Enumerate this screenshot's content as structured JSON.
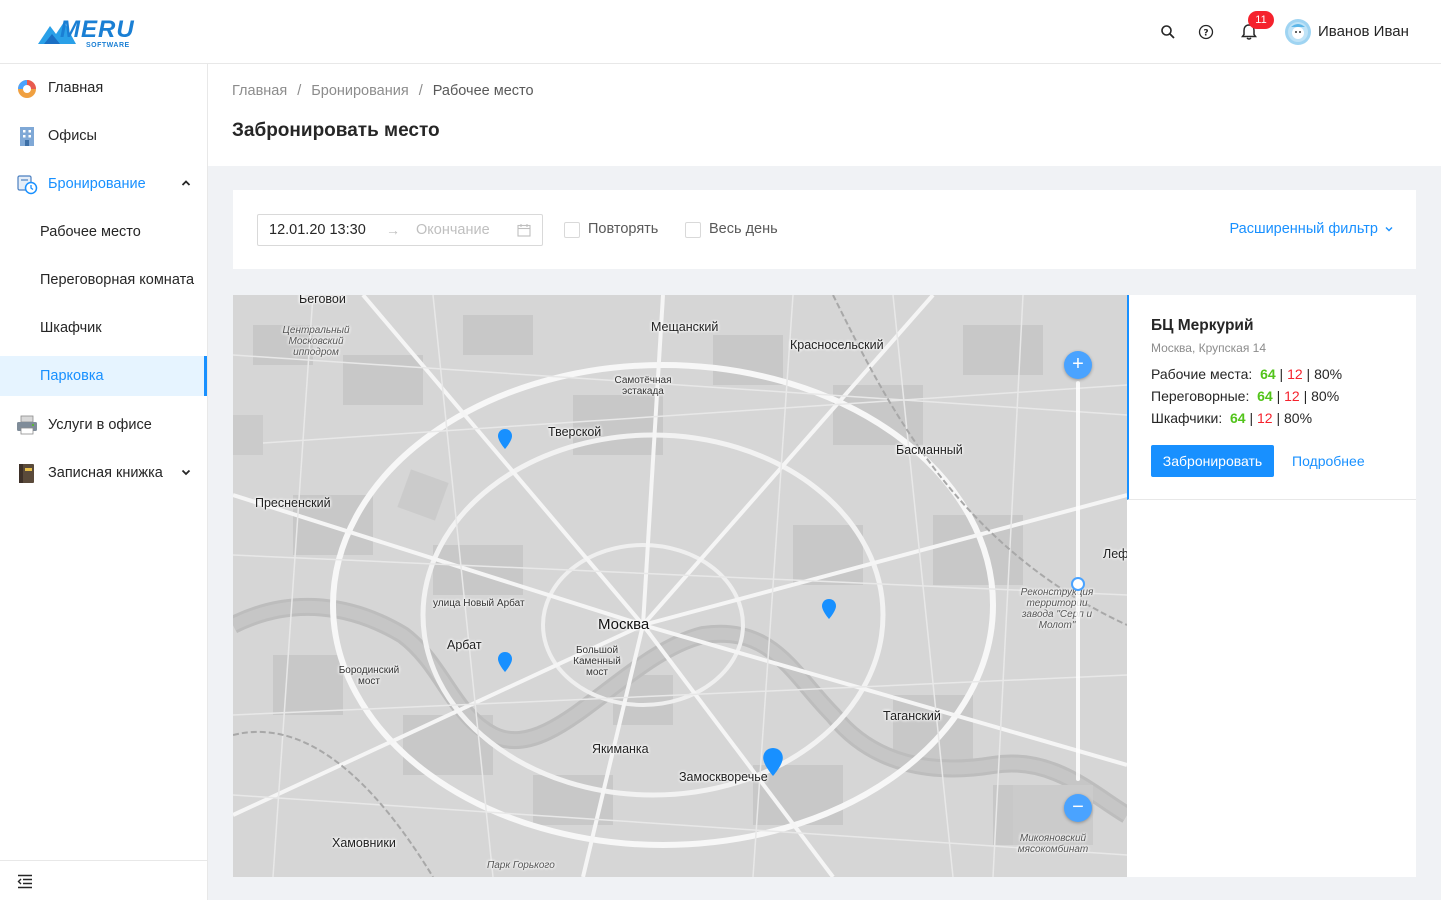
{
  "brand": {
    "logo_text": "MERU",
    "logo_sub": "SOFTWARE"
  },
  "header": {
    "notifications_count": "11",
    "user_name": "Иванов Иван",
    "icons": [
      "search-icon",
      "help-icon",
      "bell-icon"
    ]
  },
  "sidebar": {
    "items": [
      {
        "label": "Главная",
        "icon": "dashboard-icon"
      },
      {
        "label": "Офисы",
        "icon": "building-icon"
      },
      {
        "label": "Бронирование",
        "icon": "booking-icon"
      },
      {
        "label": "Услуги в офисе",
        "icon": "printer-icon"
      },
      {
        "label": "Записная книжка",
        "icon": "notebook-icon"
      }
    ],
    "booking_sub": [
      {
        "label": "Рабочее место"
      },
      {
        "label": "Переговорная комната"
      },
      {
        "label": "Шкафчик"
      },
      {
        "label": "Парковка"
      }
    ],
    "active_sub": "Парковка"
  },
  "breadcrumb": [
    "Главная",
    "Бронирования",
    "Рабочее место"
  ],
  "page_title": "Забронировать место",
  "filter": {
    "start_value": "12.01.20 13:30",
    "end_placeholder": "Окончание",
    "repeat_label": "Повторять",
    "allday_label": "Весь день",
    "advanced_label": "Расширенный фильтр"
  },
  "map": {
    "labels": {
      "meshchansky": "Мещанский",
      "krasnoselsky": "Красносельский",
      "tverskoy": "Тверской",
      "basmanny": "Басманный",
      "presnensky": "Пресненский",
      "arbat": "Арбат",
      "moscow": "Москва",
      "borodinsky": "Бородинский мост",
      "bolshoy_kamenny": "Большой Каменный мост",
      "tagansky": "Таганский",
      "yakimanka": "Якиманка",
      "zamoskvorechye": "Замоскворечье",
      "khamovniki": "Хамовники",
      "begovoy": "Беговой",
      "samotechnaya": "Самотёчная эстакада",
      "novy_arbat": "улица Новый Арбат",
      "hippodrome": "Центральный Московский ипподром",
      "lef": "Леф",
      "reconstruction": "Реконструкция территории завода \"Серп и Молот\"",
      "mikoyan": "Микояновский мясокомбинат",
      "gorky_park": "Парк Горького"
    },
    "zoom_in": "+",
    "zoom_out": "−",
    "zoom_level": 0.5
  },
  "office": {
    "name": "БЦ Меркурий",
    "address": "Москва, Крупская 14",
    "stats": [
      {
        "label": "Рабочие места",
        "free": "64",
        "busy": "12",
        "percent": "80%"
      },
      {
        "label": "Переговорные",
        "free": "64",
        "busy": "12",
        "percent": "80%"
      },
      {
        "label": "Шкафчики",
        "free": "64",
        "busy": "12",
        "percent": "80%"
      }
    ],
    "book_label": "Забронировать",
    "more_label": "Подробнее"
  }
}
